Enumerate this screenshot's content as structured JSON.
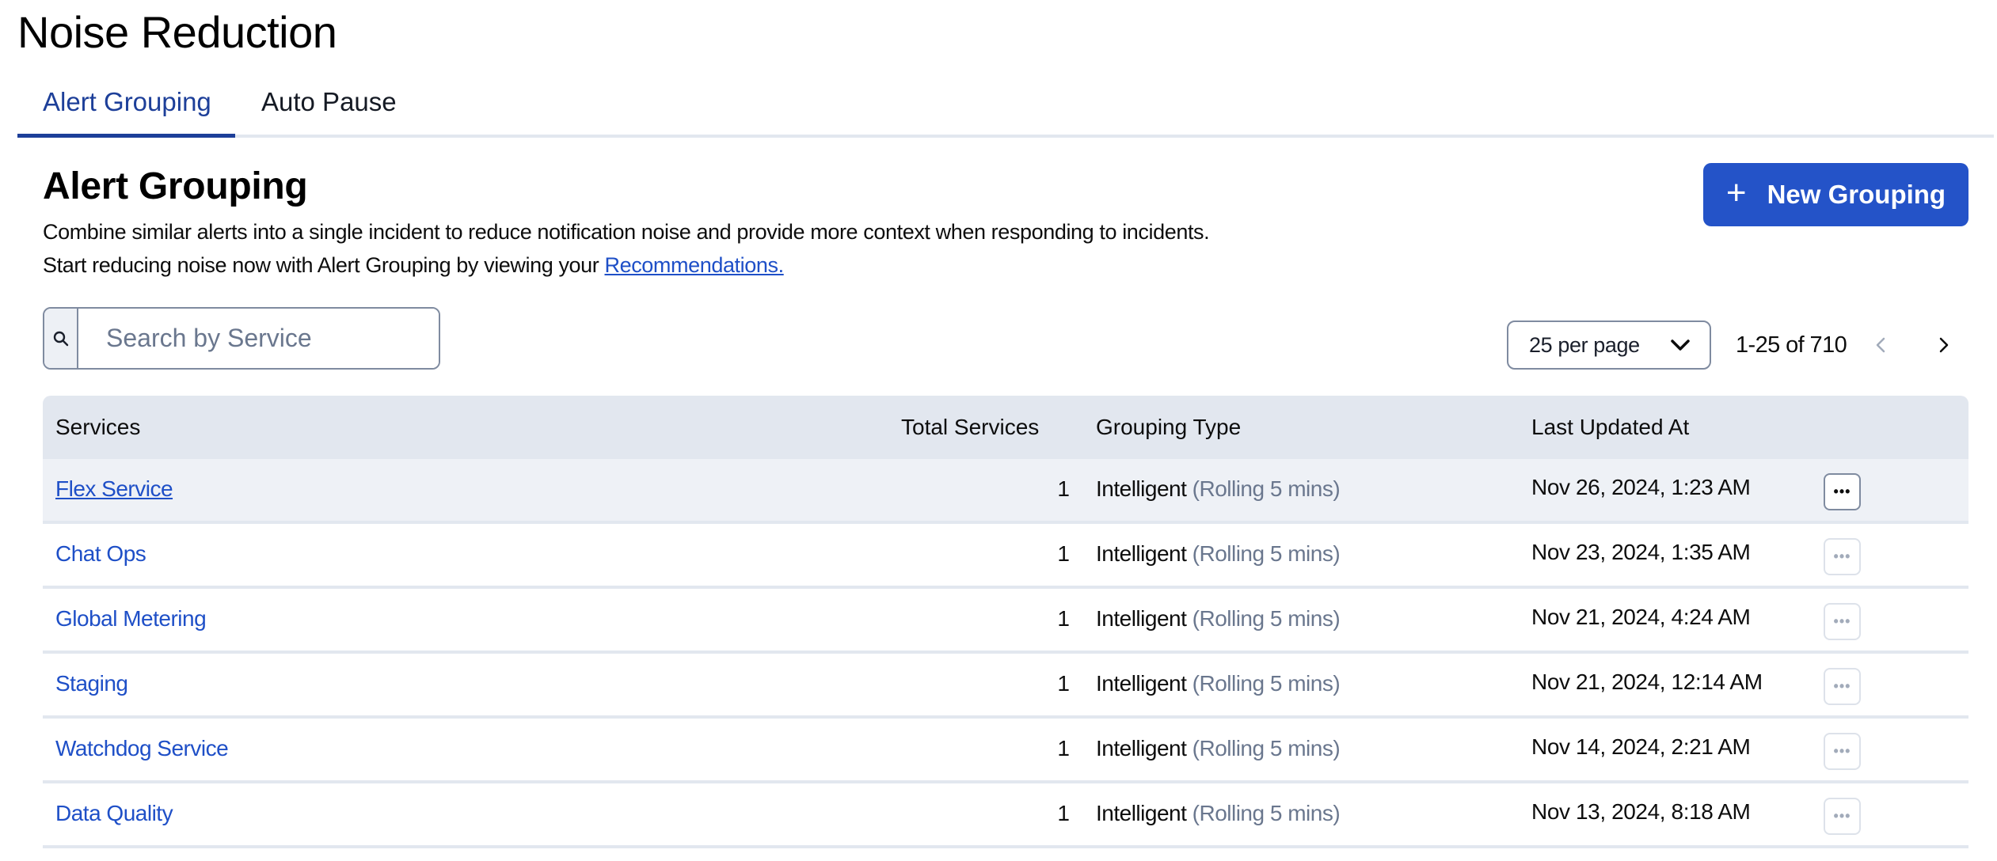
{
  "page": {
    "title": "Noise Reduction"
  },
  "tabs": [
    {
      "label": "Alert Grouping",
      "active": true
    },
    {
      "label": "Auto Pause",
      "active": false
    }
  ],
  "section": {
    "title": "Alert Grouping",
    "description_line1": "Combine similar alerts into a single incident to reduce notification noise and provide more context when responding to incidents.",
    "description_line2_prefix": "Start reducing noise now with Alert Grouping by viewing your ",
    "recommendations_link": "Recommendations."
  },
  "toolbar": {
    "new_button_label": "New Grouping",
    "new_button_icon": "plus-icon",
    "search_placeholder": "Search by Service",
    "search_value": "",
    "per_page_selected": "25 per page",
    "range_text": "1-25 of 710",
    "prev_disabled": true
  },
  "table": {
    "columns": [
      "Services",
      "Total Services",
      "Grouping Type",
      "Last Updated At"
    ],
    "rows": [
      {
        "service": "Flex Service",
        "total": "1",
        "type": "Intelligent",
        "type_detail": "(Rolling 5 mins)",
        "updated": "Nov 26, 2024, 1:23 AM",
        "actions": "•••"
      },
      {
        "service": "Chat Ops",
        "total": "1",
        "type": "Intelligent",
        "type_detail": "(Rolling 5 mins)",
        "updated": "Nov 23, 2024, 1:35 AM",
        "actions": "•••"
      },
      {
        "service": "Global Metering",
        "total": "1",
        "type": "Intelligent",
        "type_detail": "(Rolling 5 mins)",
        "updated": "Nov 21, 2024, 4:24 AM",
        "actions": "•••"
      },
      {
        "service": "Staging",
        "total": "1",
        "type": "Intelligent",
        "type_detail": "(Rolling 5 mins)",
        "updated": "Nov 21, 2024, 12:14 AM",
        "actions": "•••"
      },
      {
        "service": "Watchdog Service",
        "total": "1",
        "type": "Intelligent",
        "type_detail": "(Rolling 5 mins)",
        "updated": "Nov 14, 2024, 2:21 AM",
        "actions": "•••"
      },
      {
        "service": "Data Quality",
        "total": "1",
        "type": "Intelligent",
        "type_detail": "(Rolling 5 mins)",
        "updated": "Nov 13, 2024, 8:18 AM",
        "actions": "•••"
      }
    ]
  },
  "colors": {
    "accent": "#2453c8",
    "link": "#1e4fc7",
    "tab_active": "#1d3f99",
    "header_bg": "#e2e7ef",
    "muted_text": "#6a778e"
  }
}
